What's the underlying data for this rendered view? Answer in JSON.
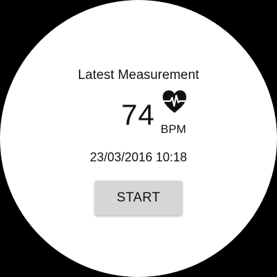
{
  "screen": {
    "title": "Latest Measurement",
    "heart_rate": {
      "value": "74",
      "unit": "BPM",
      "icon": "heart-pulse-icon"
    },
    "timestamp": "23/03/2016 10:18",
    "start_button_label": "START"
  },
  "colors": {
    "background": "#000000",
    "face": "#ffffff",
    "text": "#111111",
    "button": "#d6d6d6"
  }
}
